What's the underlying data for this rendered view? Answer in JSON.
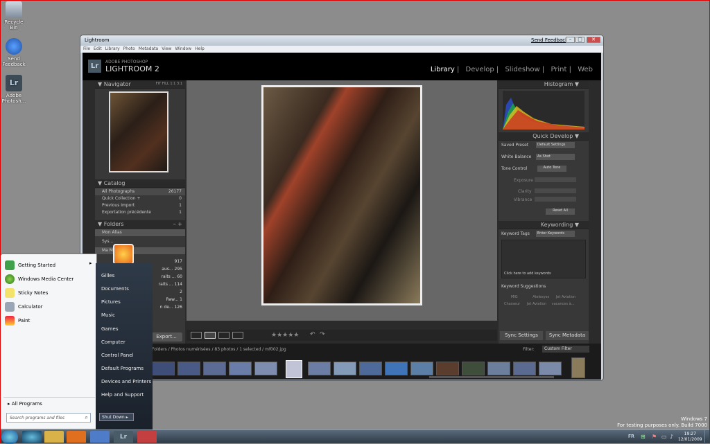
{
  "desktop": {
    "icons": [
      {
        "label": "Recycle Bin"
      },
      {
        "label": "Send Feedback"
      },
      {
        "label": "Adobe Photosh..."
      }
    ],
    "watermark": {
      "line1": "Windows 7",
      "line2": "For testing purposes only. Build 7000"
    }
  },
  "window": {
    "title": "Lightroom",
    "send_feedback": "Send Feedback",
    "menu": [
      "File",
      "Edit",
      "Library",
      "Photo",
      "Metadata",
      "View",
      "Window",
      "Help"
    ]
  },
  "app": {
    "brand_top": "ADOBE PHOTOSHOP",
    "brand_main": "LIGHTROOM 2",
    "logo": "Lr",
    "modules": [
      "Library",
      "Develop",
      "Slideshow",
      "Print",
      "Web"
    ],
    "active_module": "Library",
    "navigator": {
      "title": "Navigator",
      "zoom": [
        "FIT",
        "FILL",
        "1:1",
        "3:1"
      ]
    },
    "catalog": {
      "title": "Catalog",
      "items": [
        {
          "label": "All Photographs",
          "count": "26177"
        },
        {
          "label": "Quick Collection +",
          "count": "0"
        },
        {
          "label": "Previous Import",
          "count": "1"
        },
        {
          "label": "Exportation précédente",
          "count": "1"
        }
      ]
    },
    "folders": {
      "title": "Folders",
      "rows": [
        {
          "label": "Mon Alias"
        },
        {
          "label": "Sys..."
        },
        {
          "label": "Ma Ma..."
        }
      ],
      "counts": [
        "917",
        "295",
        "60",
        "114",
        "2",
        "1",
        "126"
      ],
      "frags": [
        "aus...",
        "raits ...",
        "raits ...",
        "Raw...",
        "n de..."
      ]
    },
    "export_btn": "Export...",
    "histogram": {
      "title": "Histogram"
    },
    "quick_develop": {
      "title": "Quick Develop",
      "saved_preset_label": "Saved Preset",
      "saved_preset_value": "Default Settings",
      "wb_label": "White Balance",
      "wb_value": "As Shot",
      "tone_label": "Tone Control",
      "auto_tone": "Auto Tone",
      "exposure": "Exposure",
      "clarity": "Clarity",
      "vibrance": "Vibrance",
      "reset": "Reset All"
    },
    "keywording": {
      "title": "Keywording",
      "tags_label": "Keyword Tags",
      "tags_value": "Enter Keywords",
      "click_here": "Click here to add keywords",
      "suggestions": "Keyword Suggestions",
      "sugg": [
        "MIG",
        "Atelesyes",
        "Jet Aviation",
        "Chasseur",
        "Jet Aviation",
        "vacances à..."
      ]
    },
    "sync_settings": "Sync Settings",
    "sync_metadata": "Sync Metadata",
    "filmstrip": {
      "path": "Folders / Photos numérisées / 83 photos / 1 selected / mf002.jpg",
      "filter_label": "Filter:",
      "filter_value": "Custom Filter"
    },
    "toolbar": {
      "stars": "★★★★★"
    }
  },
  "start_menu": {
    "pinned": [
      {
        "label": "Getting Started"
      },
      {
        "label": "Windows Media Center"
      },
      {
        "label": "Sticky Notes"
      },
      {
        "label": "Calculator"
      },
      {
        "label": "Paint"
      }
    ],
    "all_programs": "All Programs",
    "search_placeholder": "Search programs and files",
    "right": [
      "Gilles",
      "Documents",
      "Pictures",
      "Music",
      "Games",
      "Computer",
      "Control Panel",
      "Default Programs",
      "Devices and Printers",
      "Help and Support"
    ],
    "shutdown": "Shut Down"
  },
  "taskbar": {
    "lang": "FR",
    "time": "19:27",
    "date": "12/01/2009"
  },
  "colors": {
    "accent": "#f2a000",
    "lr_bg": "#2b2b2b"
  }
}
